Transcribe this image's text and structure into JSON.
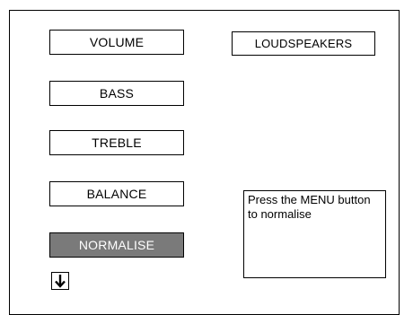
{
  "menu": {
    "items": [
      {
        "label": "VOLUME"
      },
      {
        "label": "BASS"
      },
      {
        "label": "TREBLE"
      },
      {
        "label": "BALANCE"
      },
      {
        "label": "NORMALISE",
        "selected": true
      }
    ],
    "right_item": {
      "label": "LOUDSPEAKERS"
    }
  },
  "info": {
    "text": "Press the MENU button to normalise"
  },
  "navigation": {
    "down_icon": "arrow-down-icon"
  },
  "colors": {
    "selected_background": "#7a7a7a",
    "selected_text": "#ffffff",
    "border": "#000000"
  }
}
